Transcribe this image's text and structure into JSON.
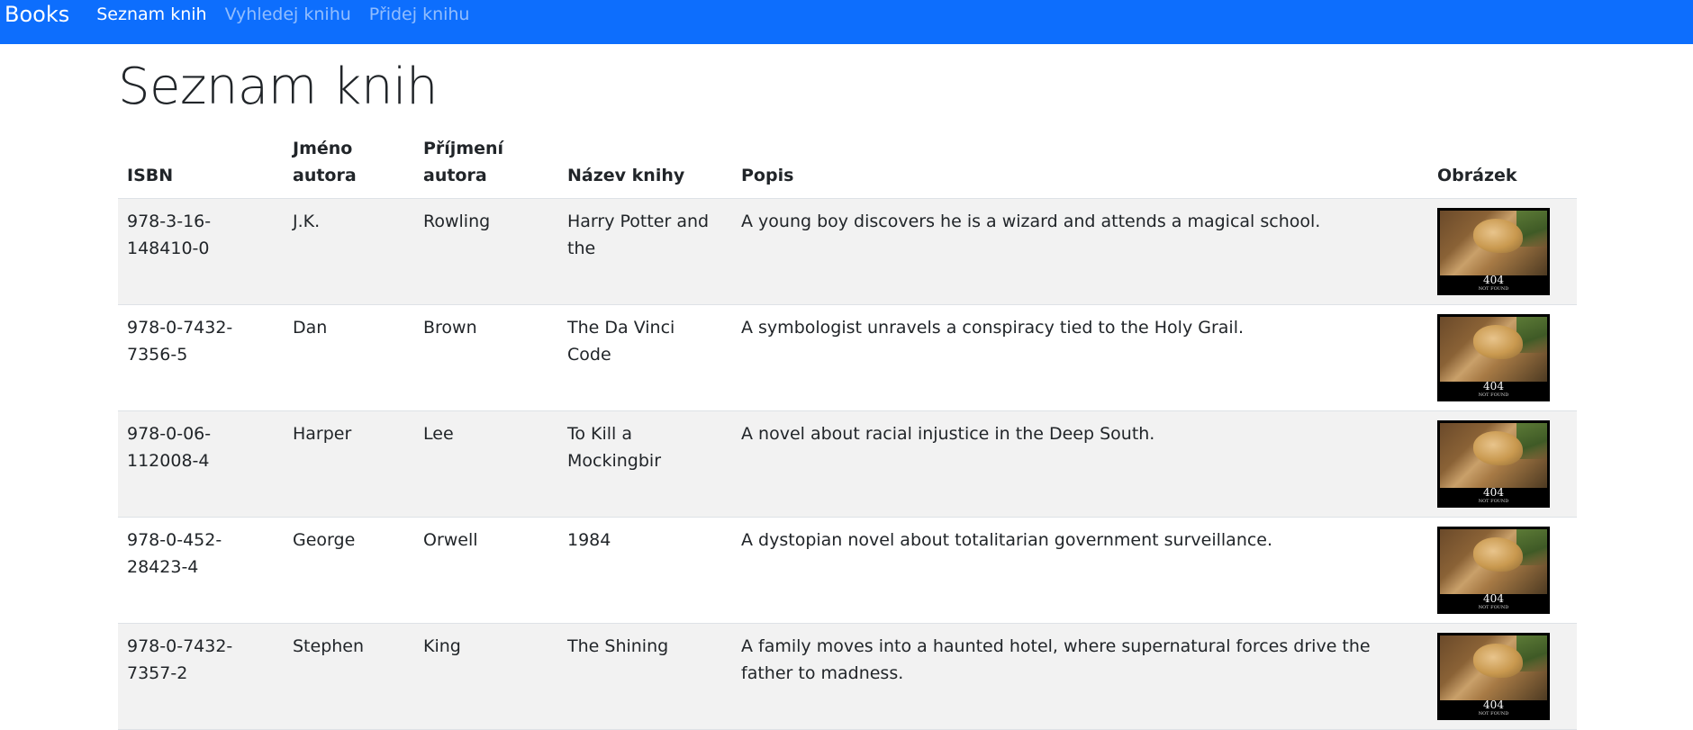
{
  "navbar": {
    "brand": "Books",
    "links": [
      {
        "label": "Seznam knih",
        "active": true
      },
      {
        "label": "Vyhledej knihu",
        "active": false
      },
      {
        "label": "Přidej knihu",
        "active": false
      }
    ],
    "color": "#0d6efd"
  },
  "page": {
    "title": "Seznam knih"
  },
  "table": {
    "headers": [
      "ISBN",
      "Jméno autora",
      "Příjmení autora",
      "Název knihy",
      "Popis",
      "Obrázek"
    ],
    "rows": [
      {
        "isbn": "978-3-16-148410-0",
        "first": "J.K.",
        "last": "Rowling",
        "title": "Harry Potter and the",
        "desc": "A young boy discovers he is a wizard and attends a magical school.",
        "img_code": "404",
        "img_sub": "NOT FOUND"
      },
      {
        "isbn": "978-0-7432-7356-5",
        "first": "Dan",
        "last": "Brown",
        "title": "The Da Vinci Code",
        "desc": "A symbologist unravels a conspiracy tied to the Holy Grail.",
        "img_code": "404",
        "img_sub": "NOT FOUND"
      },
      {
        "isbn": "978-0-06-112008-4",
        "first": "Harper",
        "last": "Lee",
        "title": "To Kill a Mockingbir",
        "desc": "A novel about racial injustice in the Deep South.",
        "img_code": "404",
        "img_sub": "NOT FOUND"
      },
      {
        "isbn": "978-0-452-28423-4",
        "first": "George",
        "last": "Orwell",
        "title": "1984",
        "desc": "A dystopian novel about totalitarian government surveillance.",
        "img_code": "404",
        "img_sub": "NOT FOUND"
      },
      {
        "isbn": "978-0-7432-7357-2",
        "first": "Stephen",
        "last": "King",
        "title": "The Shining",
        "desc": "A family moves into a haunted hotel, where supernatural forces drive the father to madness.",
        "img_code": "404",
        "img_sub": "NOT FOUND"
      }
    ]
  }
}
